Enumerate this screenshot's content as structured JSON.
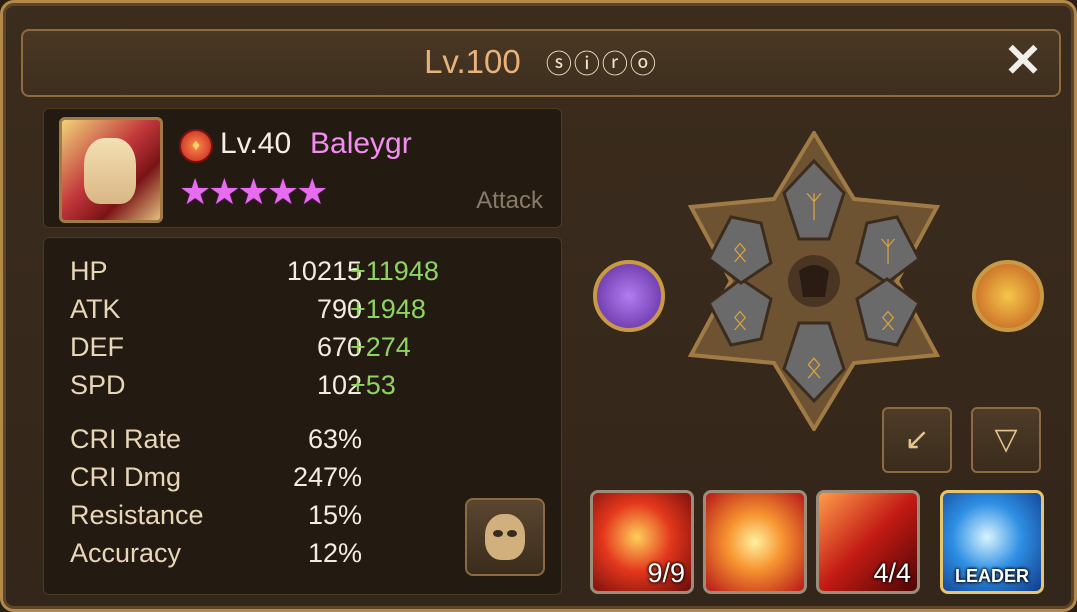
{
  "header": {
    "level": "Lv.100",
    "guild_name": "ⓢⓘⓡⓞ",
    "close_label": "✕"
  },
  "monster": {
    "element_icon": "fire-element-icon",
    "level": "Lv.40",
    "name": "Baleygr",
    "stars": "★★★★★",
    "type": "Attack"
  },
  "stats": [
    {
      "label": "HP",
      "value": "10215",
      "bonus": "+11948"
    },
    {
      "label": "ATK",
      "value": "790",
      "bonus": "+1948"
    },
    {
      "label": "DEF",
      "value": "670",
      "bonus": "+274"
    },
    {
      "label": "SPD",
      "value": "102",
      "bonus": "+53"
    },
    {
      "label": "CRI Rate",
      "value": "63%",
      "bonus": ""
    },
    {
      "label": "CRI Dmg",
      "value": "247%",
      "bonus": ""
    },
    {
      "label": "Resistance",
      "value": "15%",
      "bonus": ""
    },
    {
      "label": "Accuracy",
      "value": "12%",
      "bonus": ""
    }
  ],
  "skills": [
    {
      "icon": "fire-vortex-skill-icon",
      "count": "9/9"
    },
    {
      "icon": "fire-slash-skill-icon",
      "count": ""
    },
    {
      "icon": "fire-strike-skill-icon",
      "count": "4/4"
    },
    {
      "icon": "sword-leader-skill-icon",
      "count": "",
      "label": "LEADER"
    }
  ],
  "colors": {
    "accent": "#b38a4a",
    "bonus": "#8fd462",
    "name": "#f28ef0",
    "stars": "#e76cf0"
  }
}
